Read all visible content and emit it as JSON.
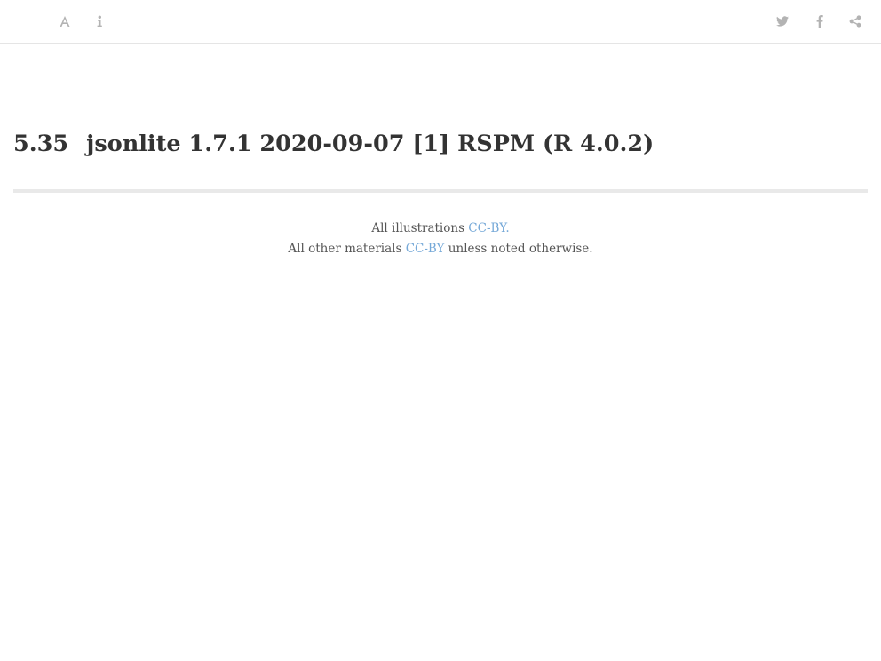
{
  "toolbar": {
    "left_icons": [
      "font-settings-icon",
      "info-icon"
    ],
    "right_icons": [
      "twitter-icon",
      "facebook-icon",
      "share-icon"
    ]
  },
  "page": {
    "section_number": "5.35",
    "title": "jsonlite 1.7.1 2020-09-07 [1] RSPM (R 4.0.2)"
  },
  "footer": {
    "line1_prefix": "All illustrations ",
    "line1_link": "CC-BY.",
    "line2_prefix": "All other materials ",
    "line2_link": "CC-BY",
    "line2_suffix": " unless noted otherwise."
  },
  "colors": {
    "link": "#76a9d8",
    "icon": "#b3b3b3",
    "text": "#333333",
    "divider": "#e9e9e9"
  }
}
